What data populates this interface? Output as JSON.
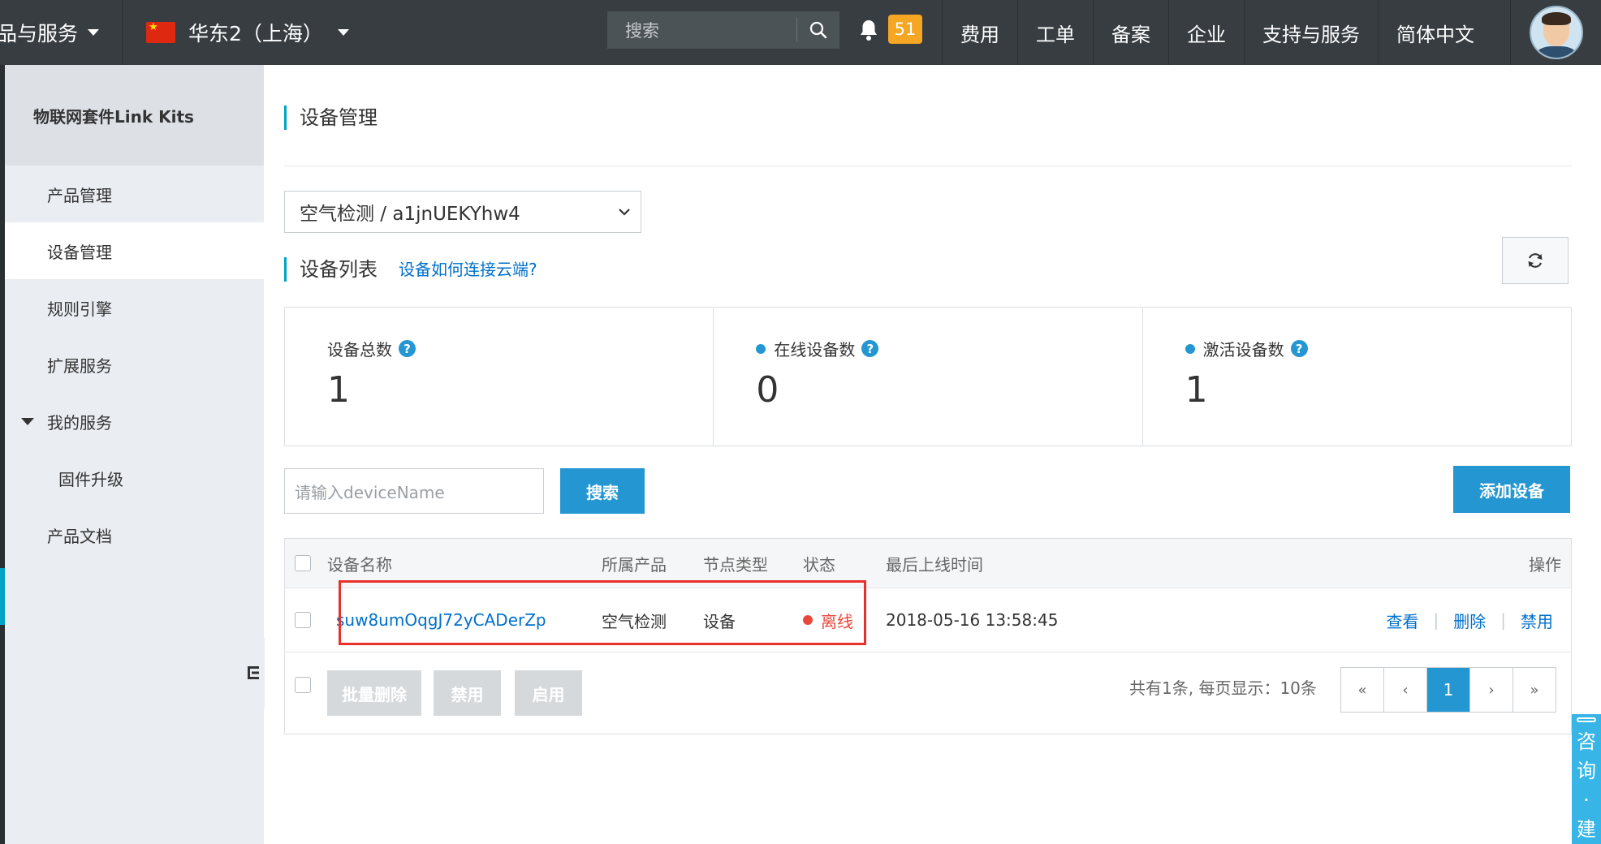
{
  "topbar": {
    "products_label": "品与服务",
    "region_label": "华东2（上海）",
    "search_placeholder": "搜索",
    "notification_count": "51",
    "nav": [
      "费用",
      "工单",
      "备案",
      "企业",
      "支持与服务",
      "简体中文"
    ],
    "colors": {
      "background": "#373d41",
      "badge": "#f5a623"
    }
  },
  "sidebar": {
    "title": "物联网套件Link Kits",
    "items": [
      {
        "label": "产品管理"
      },
      {
        "label": "设备管理",
        "active": true
      },
      {
        "label": "规则引擎"
      },
      {
        "label": "扩展服务"
      },
      {
        "label": "我的服务",
        "expanded": true
      },
      {
        "label": "固件升级",
        "sub": true
      },
      {
        "label": "产品文档"
      }
    ]
  },
  "main": {
    "page_title": "设备管理",
    "product_select": "空气检测 / a1jnUEKYhw4",
    "list_title": "设备列表",
    "help_link": "设备如何连接云端?",
    "stats": [
      {
        "label": "设备总数",
        "value": "1",
        "dot": false
      },
      {
        "label": "在线设备数",
        "value": "0",
        "dot": true
      },
      {
        "label": "激活设备数",
        "value": "1",
        "dot": true
      }
    ],
    "search": {
      "placeholder": "请输入deviceName",
      "button": "搜索"
    },
    "add_button": "添加设备",
    "table": {
      "headers": {
        "name": "设备名称",
        "product": "所属产品",
        "node_type": "节点类型",
        "status": "状态",
        "last_online": "最后上线时间",
        "actions": "操作"
      },
      "rows": [
        {
          "name": "suw8umOqgJ72yCADerZp",
          "product": "空气检测",
          "node_type": "设备",
          "status": "离线",
          "last_online": "2018-05-16 13:58:45",
          "actions": [
            "查看",
            "删除",
            "禁用"
          ]
        }
      ],
      "bulk_actions": [
        "批量删除",
        "禁用",
        "启用"
      ],
      "pagination_info": "共有1条, 每页显示：10条",
      "pager": {
        "first": "«",
        "prev": "‹",
        "current": "1",
        "next": "›",
        "last": "»"
      }
    },
    "accent_color": "#2496d2"
  },
  "consult_widget": {
    "chars": [
      "咨",
      "询",
      "·",
      "建"
    ]
  }
}
